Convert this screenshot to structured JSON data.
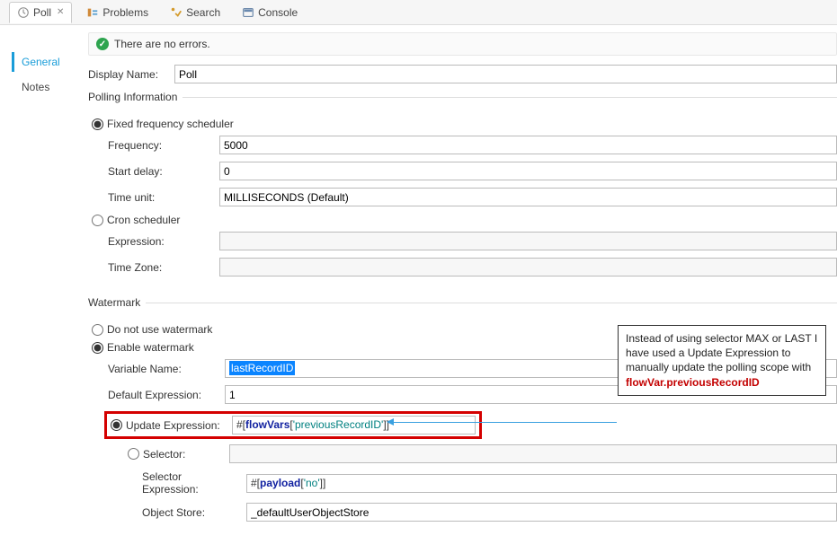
{
  "tabs": {
    "poll": {
      "label": "Poll"
    },
    "problems": {
      "label": "Problems"
    },
    "search": {
      "label": "Search"
    },
    "console": {
      "label": "Console"
    }
  },
  "sideNav": {
    "general": "General",
    "notes": "Notes"
  },
  "status": {
    "message": "There are no errors."
  },
  "displayName": {
    "label": "Display Name:",
    "value": "Poll"
  },
  "polling": {
    "legend": "Polling Information",
    "fixed": {
      "label": "Fixed frequency scheduler",
      "frequency": {
        "label": "Frequency:",
        "value": "5000"
      },
      "startDelay": {
        "label": "Start delay:",
        "value": "0"
      },
      "timeUnit": {
        "label": "Time unit:",
        "value": "MILLISECONDS (Default)"
      }
    },
    "cron": {
      "label": "Cron scheduler",
      "expression": {
        "label": "Expression:",
        "value": ""
      },
      "timeZone": {
        "label": "Time Zone:",
        "value": ""
      }
    }
  },
  "watermark": {
    "legend": "Watermark",
    "doNotUse": {
      "label": "Do not use watermark"
    },
    "enable": {
      "label": "Enable watermark"
    },
    "variableName": {
      "label": "Variable Name:",
      "value": "lastRecordID"
    },
    "defaultExpression": {
      "label": "Default Expression:",
      "value": "1"
    },
    "updateExpression": {
      "label": "Update Expression:",
      "prefix": "#[",
      "kw": "flowVars",
      "mid": "[",
      "str": "'previousRecordID'",
      "suffix": "]]"
    },
    "selector": {
      "label": "Selector:",
      "value": ""
    },
    "selectorExpression": {
      "label": "Selector Expression:",
      "prefix": "#[",
      "kw": "payload",
      "mid": "[",
      "str": "'no'",
      "suffix": "]]"
    },
    "objectStore": {
      "label": "Object Store:",
      "value": "_defaultUserObjectStore"
    }
  },
  "callout": {
    "text1": "Instead of using selector MAX or LAST I have used a Update Expression to manually update the polling scope with ",
    "flowvar": "flowVar.previousRecordID"
  }
}
